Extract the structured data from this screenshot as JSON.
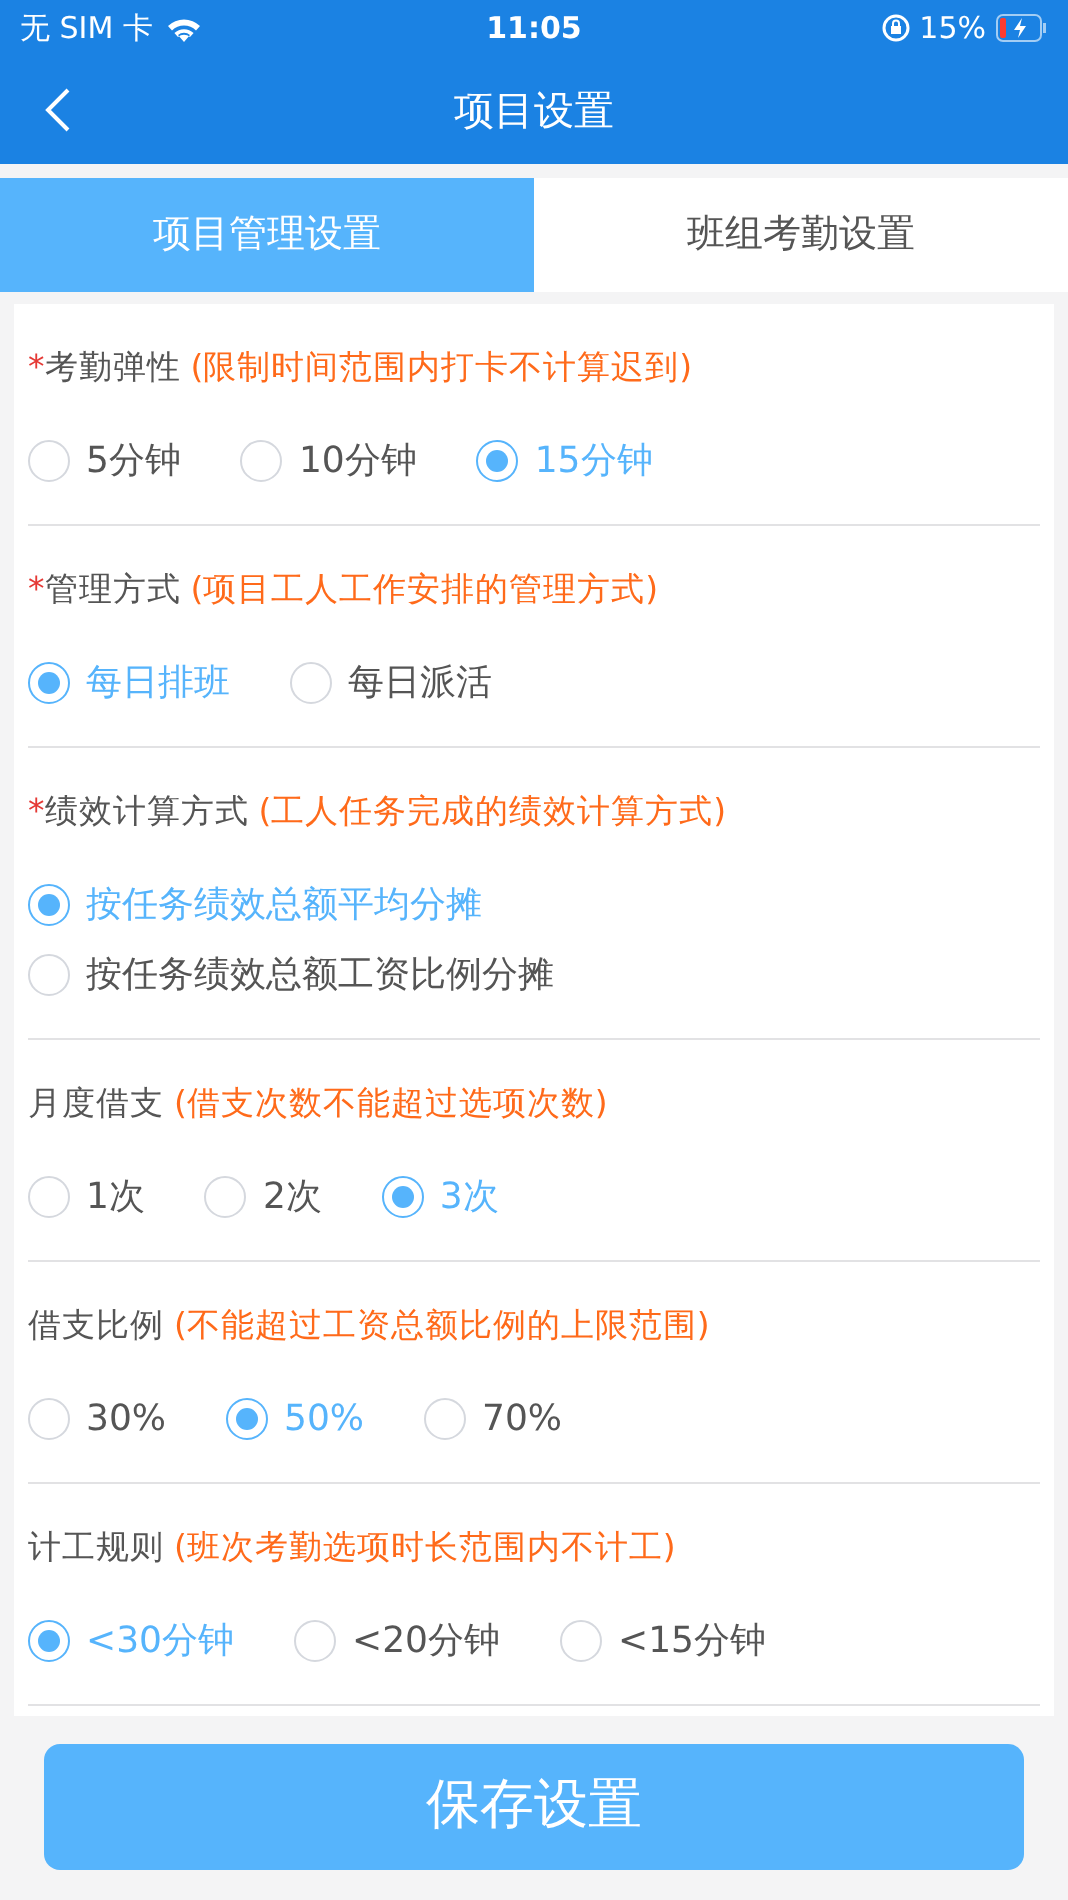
{
  "status_bar": {
    "carrier": "无 SIM 卡",
    "time": "11:05",
    "battery": "15%"
  },
  "nav": {
    "title": "项目设置"
  },
  "tabs": [
    {
      "label": "项目管理设置",
      "selected": true
    },
    {
      "label": "班组考勤设置",
      "selected": false
    }
  ],
  "sections": [
    {
      "required_mark": "*",
      "title": "考勤弹性",
      "hint": "(限制时间范围内打卡不计算迟到)",
      "kind": "row",
      "options": [
        {
          "label": "5分钟",
          "selected": false
        },
        {
          "label": "10分钟",
          "selected": false
        },
        {
          "label": "15分钟",
          "selected": true
        }
      ]
    },
    {
      "required_mark": "*",
      "title": "管理方式",
      "hint": "(项目工人工作安排的管理方式)",
      "kind": "row",
      "options": [
        {
          "label": "每日排班",
          "selected": true
        },
        {
          "label": "每日派活",
          "selected": false
        }
      ]
    },
    {
      "required_mark": "*",
      "title": "绩效计算方式",
      "hint": "(工人任务完成的绩效计算方式)",
      "kind": "column",
      "options": [
        {
          "label": "按任务绩效总额平均分摊",
          "selected": true
        },
        {
          "label": "按任务绩效总额工资比例分摊",
          "selected": false
        }
      ]
    },
    {
      "title": "月度借支",
      "hint": "(借支次数不能超过选项次数)",
      "kind": "row",
      "options": [
        {
          "label": "1次",
          "selected": false
        },
        {
          "label": "2次",
          "selected": false
        },
        {
          "label": "3次",
          "selected": true
        }
      ]
    },
    {
      "title": "借支比例",
      "hint": "(不能超过工资总额比例的上限范围)",
      "kind": "row",
      "options": [
        {
          "label": "30%",
          "selected": false
        },
        {
          "label": "50%",
          "selected": true
        },
        {
          "label": "70%",
          "selected": false
        }
      ]
    },
    {
      "title": "计工规则",
      "hint": "(班次考勤选项时长范围内不计工)",
      "kind": "row",
      "options": [
        {
          "label": "<30分钟",
          "selected": true
        },
        {
          "label": "<20分钟",
          "selected": false
        },
        {
          "label": "<15分钟",
          "selected": false
        }
      ]
    }
  ],
  "save_button": "保存设置"
}
